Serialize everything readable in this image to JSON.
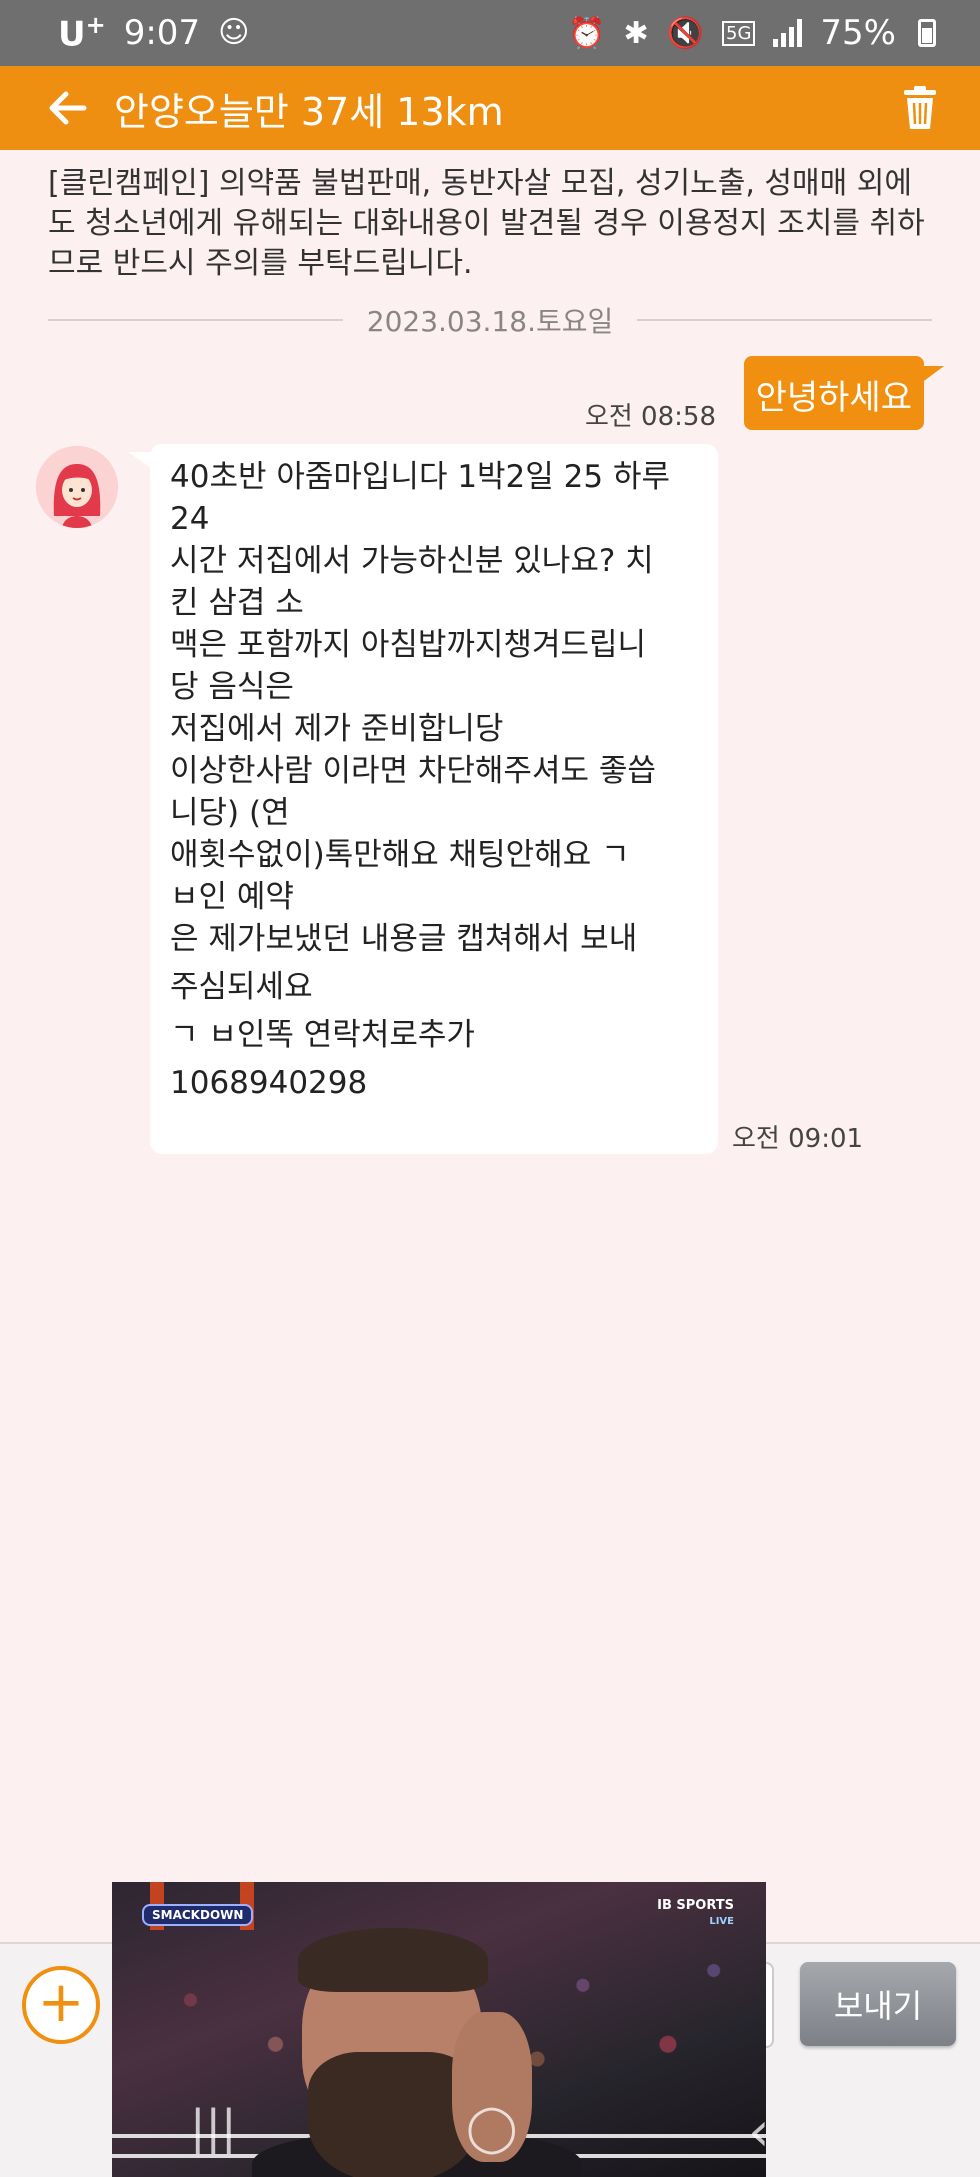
{
  "status_bar": {
    "carrier": "U",
    "carrier_plus": "+",
    "time": "9:07",
    "battery": "75%",
    "network": "5G"
  },
  "header": {
    "title": "안양오늘만 37세 13km"
  },
  "notice": "[클린캠페인] 의약품 불법판매, 동반자살 모집, 성기노출, 성매매 외에도 청소년에게 유해되는 대화내용이 발견될 경우 이용정지 조치를 취하므로 반드시 주의를 부탁드립니다.",
  "date_divider": "2023.03.18.토요일",
  "messages": {
    "outgoing": {
      "text": "안녕하세요",
      "time": "오전 08:58"
    },
    "incoming": {
      "lines": [
        "40초반 아줌마입니다 1박2일 25 하루",
        "24",
        "시간 저집에서 가능하신분 있나요? 치",
        "킨 삼겹 소",
        "맥은 포함까지 아침밥까지챙겨드립니",
        "당 음식은",
        "저집에서 제가 준비합니당",
        "이상한사람 이라면 차단해주셔도 좋씁",
        "니당) (연",
        "애횟수없이)톡만해요 채팅안해요 ㄱ",
        "ㅂ인 예약",
        "은 제가보냈던 내용글 캡쳐해서 보내",
        "주심되세요",
        "ㄱ ㅂ인똑 연락처로추가",
        "1068940298"
      ],
      "time": "오전 09:01"
    }
  },
  "input_bar": {
    "add_symbol": "+",
    "send_label": "보내기"
  },
  "pip": {
    "show_logo": "SMACKDOWN",
    "broadcaster": "IB SPORTS",
    "live_label": "LIVE"
  },
  "nav": {
    "recents": "|||",
    "home": "◯",
    "back": "‹"
  },
  "colors": {
    "accent": "#ef8f12",
    "background": "#fdf0f0",
    "status_bar": "#6f6f6f"
  }
}
